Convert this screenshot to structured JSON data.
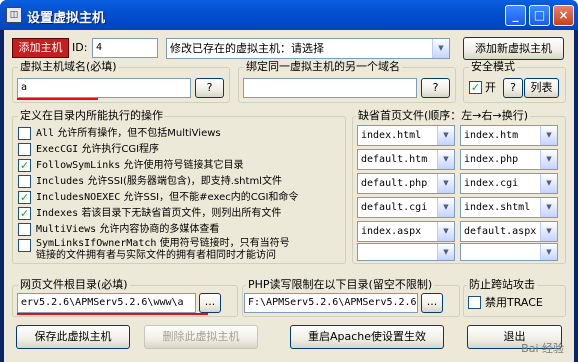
{
  "window": {
    "title": "设置虚拟主机",
    "icon": "app-icon",
    "controls": {
      "minimize": "_",
      "maximize": "□",
      "close": "×"
    }
  },
  "top": {
    "add_host_label": "添加主机",
    "id_label": "ID:",
    "id_value": "4",
    "existing_select": "修改已存在的虚拟主机：请选择",
    "add_new_button": "添加新虚拟主机"
  },
  "domain_group": {
    "title": "虚拟主机域名(必填)",
    "value": "a",
    "help": "?"
  },
  "bind_group": {
    "title": "绑定同一虚拟主机的另一个域名",
    "value": "",
    "help": "?"
  },
  "security_group": {
    "title": "安全模式",
    "checkbox_label": "开",
    "help": "?",
    "list_button": "列表"
  },
  "operations_group": {
    "title": "定义在目录内所能执行的操作",
    "options": [
      {
        "mono": "All",
        "text": " 允许所有操作，但不包括MultiViews",
        "checked": false
      },
      {
        "mono": "ExecCGI",
        "text": " 允许执行CGI程序",
        "checked": false
      },
      {
        "mono": "FollowSymLinks",
        "text": " 允许使用符号链接其它目录",
        "checked": true
      },
      {
        "mono": "Includes",
        "text": " 允许SSI(服务器端包含)，即支持.shtml文件",
        "checked": false
      },
      {
        "mono": "IncludesNOEXEC",
        "text": " 允许SSI，但不能#exec内的CGI和命令",
        "checked": true
      },
      {
        "mono": "Indexes",
        "text": " 若该目录下无缺省首页文件，则列出所有文件",
        "checked": true
      },
      {
        "mono": "MultiViews",
        "text": " 允许内容协商的多媒体查看",
        "checked": false
      },
      {
        "mono": "SymLinksIfOwnerMatch",
        "text": " 使用符号链接时，只有当符号",
        "text2": "链接的文件拥有者与实际文件的拥有者相同时才能访问",
        "checked": false
      }
    ]
  },
  "default_pages_group": {
    "title": "缺省首页文件(顺序：左→右→换行)",
    "rows": [
      [
        "index.html",
        "index.htm"
      ],
      [
        "default.htm",
        "index.php"
      ],
      [
        "default.php",
        "index.cgi"
      ],
      [
        "default.cgi",
        "index.shtml"
      ],
      [
        "index.aspx",
        "default.aspx"
      ],
      [
        "",
        ""
      ]
    ]
  },
  "webroot_group": {
    "title": "网页文件根目录(必填)",
    "value": "erv5.2.6\\APMServ5.2.6\\www\\a",
    "browse": "..."
  },
  "php_group": {
    "title": "PHP读写限制在以下目录(留空不限制)",
    "value": "F:\\APMServ5.2.6\\APMServ5.2.6",
    "browse": "..."
  },
  "hotlink_group": {
    "title": "防止跨站攻击",
    "checkbox_label": "禁用TRACE"
  },
  "footer": {
    "save": "保存此虚拟主机",
    "delete": "删除此虚拟主机",
    "restart": "重启Apache使设置生效",
    "exit": "退出"
  },
  "watermark": "Bai 经验"
}
